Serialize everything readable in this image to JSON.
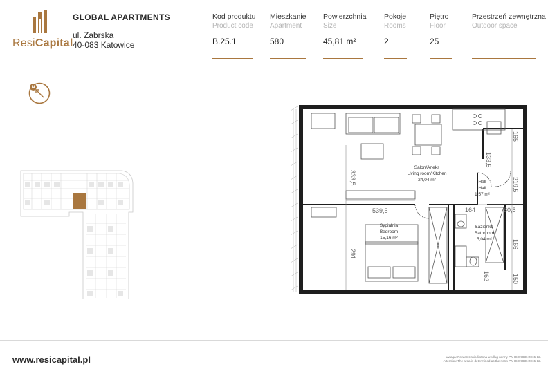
{
  "brand": {
    "name_part1": "Resi",
    "name_part2": "Capital",
    "color": "#a9773f"
  },
  "project": {
    "name": "GLOBAL APARTMENTS",
    "street": "ul. Zabrska",
    "city": "40-083 Katowice"
  },
  "columns": [
    {
      "label": "Kod produktu",
      "sub": "Product code",
      "value": "B.25.1"
    },
    {
      "label": "Mieszkanie",
      "sub": "Apartment",
      "value": "580"
    },
    {
      "label": "Powierzchnia",
      "sub": "Size",
      "value": "45,81 m²"
    },
    {
      "label": "Pokoje",
      "sub": "Rooms",
      "value": "2"
    },
    {
      "label": "Piętro",
      "sub": "Floor",
      "value": "25"
    },
    {
      "label": "Przestrzeń zewnętrzna",
      "sub": "Outdoor space",
      "value": ""
    }
  ],
  "compass": {
    "letter": "N"
  },
  "rooms": {
    "living": {
      "pl": "Salon/Aneks",
      "en": "Living room/Kitchen",
      "area": "24,04 m²"
    },
    "hall": {
      "pl": "Hall",
      "en": "Hall",
      "area": "1,57 m²"
    },
    "bedroom": {
      "pl": "Sypialnia",
      "en": "Bedroom",
      "area": "15,16 m²"
    },
    "bathroom": {
      "pl": "Łazienka",
      "en": "Bathroom",
      "area": "5,04 m²"
    }
  },
  "dimensions": {
    "d1": "333,5",
    "d2": "539,5",
    "d3": "291",
    "d4": "165",
    "d5": "133,5",
    "d6": "219,5",
    "d7": "164",
    "d8": "80,5",
    "d9": "166",
    "d10": "162",
    "d11": "150"
  },
  "footer": {
    "website": "www.resicapital.pl",
    "note_line1": "Uwaga: Powierzchnia liczona według normy PN-ISO 9836:2015-12.",
    "note_line2": "Attention: The area is determined as the norm PN-ISO 9836:2015-12."
  }
}
